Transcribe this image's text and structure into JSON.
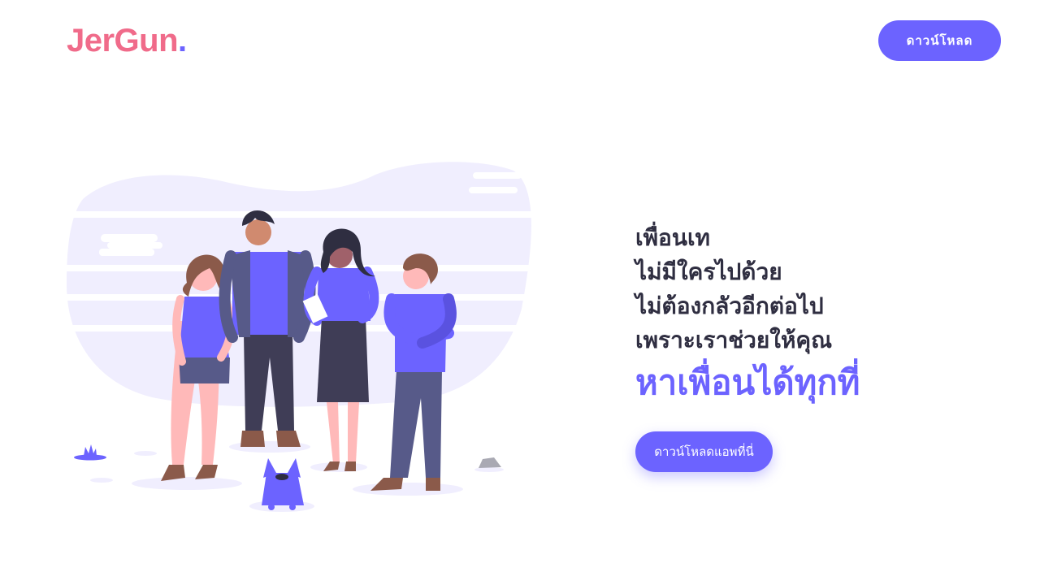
{
  "brand": {
    "name": "JerGun",
    "dot": "."
  },
  "header": {
    "download_label": "ดาวน์โหลด"
  },
  "hero": {
    "lines": [
      "เพื่อนเท",
      "ไม่มีใครไปด้วย",
      "ไม่ต้องกลัวอีกต่อไป",
      "เพราะเราช่วยให้คุณ"
    ],
    "highlight": "หาเพื่อนได้ทุกที่",
    "cta_label": "ดาวน์โหลดแอพที่นี่"
  },
  "colors": {
    "accent": "#6c63ff",
    "brand": "#f06b8a",
    "text": "#2f2e41",
    "illustration_bg": "#f0eefe"
  }
}
